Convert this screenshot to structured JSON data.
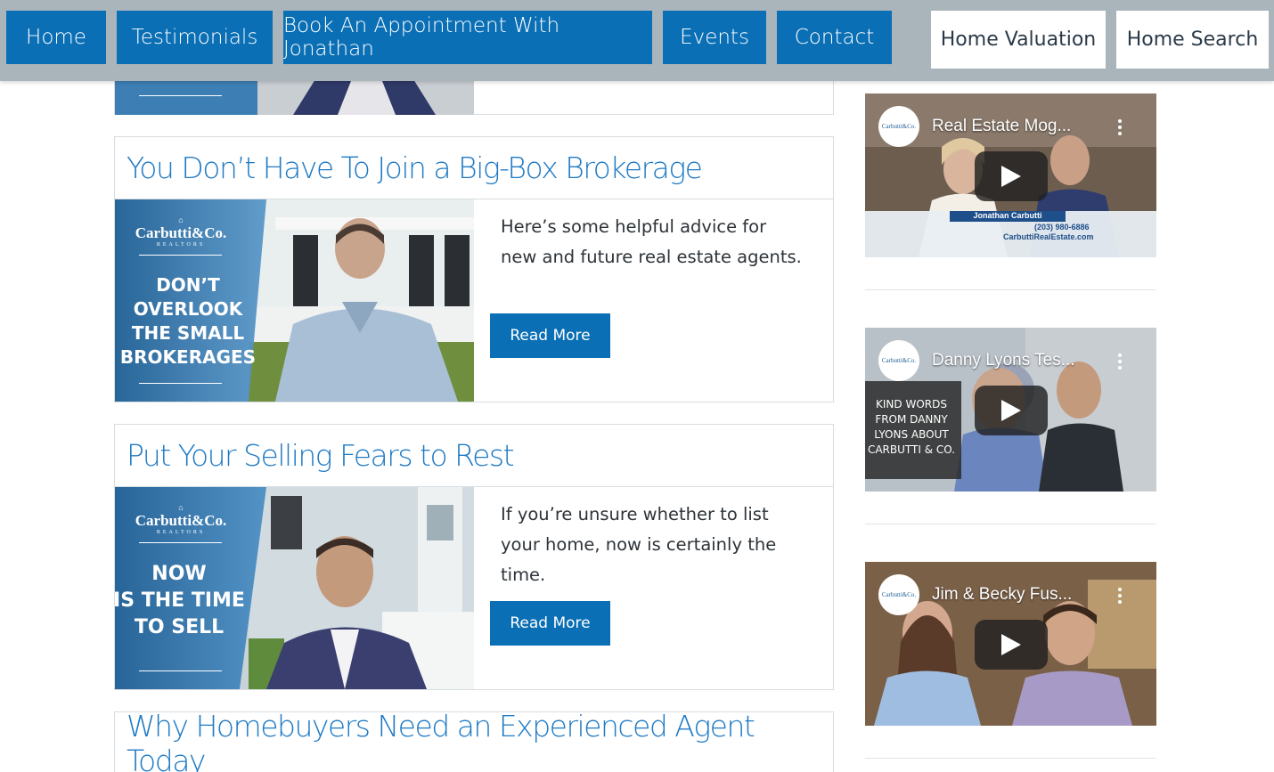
{
  "nav": {
    "home": "Home",
    "testimonials": "Testimonials",
    "book": "Book An Appointment With Jonathan",
    "events": "Events",
    "contact": "Contact",
    "home_valuation": "Home Valuation",
    "home_search": "Home Search"
  },
  "brand": {
    "name": "Carbutti&Co.",
    "sub": "REALTORS"
  },
  "posts": [
    {
      "title": "You Don’t Have To Join a Big-Box Brokerage",
      "excerpt": "Here’s some helpful advice for new and future real estate agents.",
      "read_more": "Read More",
      "thumb_lines": [
        "DON’T",
        "OVERLOOK",
        "THE SMALL",
        "BROKERAGES"
      ]
    },
    {
      "title": "Put Your Selling Fears to Rest",
      "excerpt": "If you’re unsure whether to list your home, now is certainly the time.",
      "read_more": "Read More",
      "thumb_lines": [
        "NOW",
        "IS THE TIME",
        "TO SELL"
      ]
    },
    {
      "title": "Why Homebuyers Need an Experienced Agent Today"
    }
  ],
  "videos": [
    {
      "title": "Real Estate Mog...",
      "lower_name": "Jonathan Carbutti",
      "lower_phone": "(203) 980-6886",
      "lower_site": "CarbuttiRealEstate.com"
    },
    {
      "title": "Danny Lyons Tes...",
      "overlay": [
        "KIND WORDS",
        "FROM DANNY",
        "LYONS ABOUT",
        "CARBUTTI & CO."
      ]
    },
    {
      "title": "Jim & Becky Fus..."
    }
  ],
  "colors": {
    "nav_bg": "#a9b4bb",
    "button_blue": "#0b6fb5",
    "title_blue": "#1f7ac4"
  }
}
